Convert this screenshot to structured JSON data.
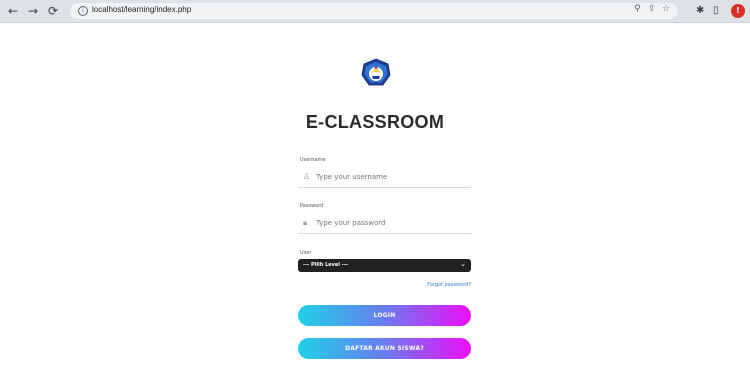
{
  "browser": {
    "url": "localhost/learning/index.php",
    "icons": [
      "back-arrow-icon",
      "forward-arrow-icon",
      "reload-icon",
      "info-icon",
      "zoom-icon",
      "share-icon",
      "star-icon",
      "extensions-icon",
      "sidebar-icon",
      "profile-avatar"
    ]
  },
  "app": {
    "title": "E-CLASSROOM"
  },
  "form": {
    "username_label": "Username",
    "username_placeholder": "Type your username",
    "password_label": "Password",
    "password_placeholder": "Type your password",
    "user_label": "User",
    "user_selected": "--- Pilih Level ---",
    "forgot_password": "Forgot password?",
    "login_button": "LOGIN",
    "register_button": "DAFTAR AKUN SISWA?"
  },
  "colors": {
    "button_gradient": [
      "#1fd1e6",
      "#6a7cf0",
      "#ee0ef8"
    ],
    "select_bg": "#212121",
    "link": "#3a80e0"
  }
}
